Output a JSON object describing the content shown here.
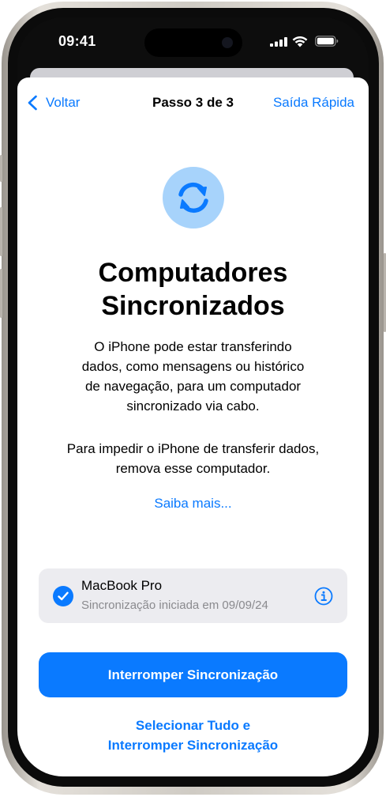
{
  "status_bar": {
    "time": "09:41"
  },
  "nav": {
    "back_label": "Voltar",
    "title": "Passo 3 de 3",
    "quick_exit_label": "Saída Rápida"
  },
  "content": {
    "title_line1": "Computadores",
    "title_line2": "Sincronizados",
    "description": [
      "O iPhone pode estar transferindo",
      "dados, como mensagens ou histórico",
      "de navegação, para um computador",
      "sincronizado via cabo."
    ],
    "instruction": [
      "Para impedir o iPhone de transferir dados,",
      "remova esse computador."
    ],
    "learn_more": "Saiba mais..."
  },
  "device": {
    "name": "MacBook Pro",
    "subtitle": "Sincronização iniciada em 09/09/24",
    "selected": true,
    "icons": {
      "check": "checkmark-icon",
      "info": "info-icon"
    }
  },
  "actions": {
    "primary": "Interromper Sincronização",
    "secondary_line1": "Selecionar Tudo e",
    "secondary_line2": "Interromper Sincronização"
  },
  "colors": {
    "accent": "#0A7AFF",
    "icon_background": "#A7D3FB",
    "card_background": "#ECECF0",
    "secondary_text": "#8A8A8E"
  }
}
